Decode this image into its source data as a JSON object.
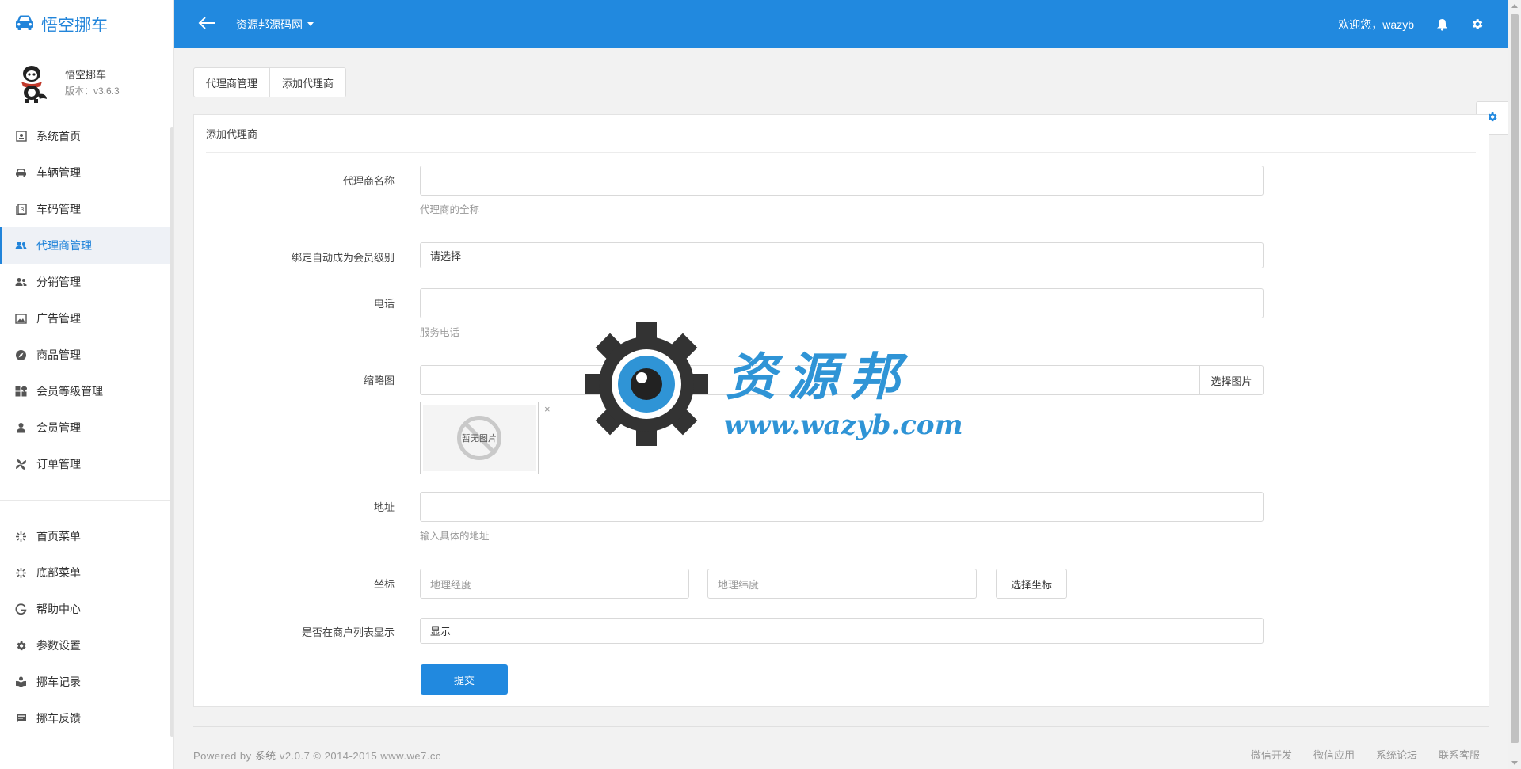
{
  "brand": {
    "name": "悟空挪车"
  },
  "profile": {
    "name": "悟空挪车",
    "version": "版本：v3.6.3"
  },
  "sidebar": {
    "items": [
      {
        "label": "系统首页",
        "icon": "dashboard-icon"
      },
      {
        "label": "车辆管理",
        "icon": "car-icon"
      },
      {
        "label": "车码管理",
        "icon": "qrcode-icon"
      },
      {
        "label": "代理商管理",
        "icon": "users-icon",
        "active": true
      },
      {
        "label": "分销管理",
        "icon": "users-icon"
      },
      {
        "label": "广告管理",
        "icon": "image-icon"
      },
      {
        "label": "商品管理",
        "icon": "compass-icon"
      },
      {
        "label": "会员等级管理",
        "icon": "grid-icon"
      },
      {
        "label": "会员管理",
        "icon": "user-icon"
      },
      {
        "label": "订单管理",
        "icon": "pinwheel-icon"
      }
    ],
    "items2": [
      {
        "label": "首页菜单",
        "icon": "sparkle-icon"
      },
      {
        "label": "底部菜单",
        "icon": "sparkle-icon"
      },
      {
        "label": "帮助中心",
        "icon": "google-icon"
      },
      {
        "label": "参数设置",
        "icon": "gear-icon"
      },
      {
        "label": "挪车记录",
        "icon": "book-icon"
      },
      {
        "label": "挪车反馈",
        "icon": "message-icon"
      }
    ]
  },
  "topbar": {
    "site": "资源邦源码网",
    "welcome": "欢迎您，wazyb"
  },
  "tabs": [
    "代理商管理",
    "添加代理商"
  ],
  "panel": {
    "heading": "添加代理商",
    "fields": {
      "name_label": "代理商名称",
      "name_help": "代理商的全称",
      "level_label": "绑定自动成为会员级别",
      "level_value": "请选择",
      "phone_label": "电话",
      "phone_help": "服务电话",
      "thumb_label": "缩略图",
      "thumb_button": "选择图片",
      "thumb_placeholder": "暂无图片",
      "thumb_close": "×",
      "address_label": "地址",
      "address_help": "输入具体的地址",
      "coord_label": "坐标",
      "lng_placeholder": "地理经度",
      "lat_placeholder": "地理纬度",
      "coord_button": "选择坐标",
      "show_label": "是否在商户列表显示",
      "show_value": "显示"
    },
    "submit": "提交"
  },
  "watermark": {
    "cn": "资源邦",
    "url": "www.wazyb.com"
  },
  "footer": {
    "powered_prefix": "Powered by ",
    "powered_name": "系统",
    "powered_suffix": " v2.0.7 © 2014-2015 www.we7.cc",
    "links": [
      "微信开发",
      "微信应用",
      "系统论坛",
      "联系客服"
    ]
  },
  "colors": {
    "primary": "#2189df",
    "sidebar_active_bg": "#eef1f6"
  }
}
